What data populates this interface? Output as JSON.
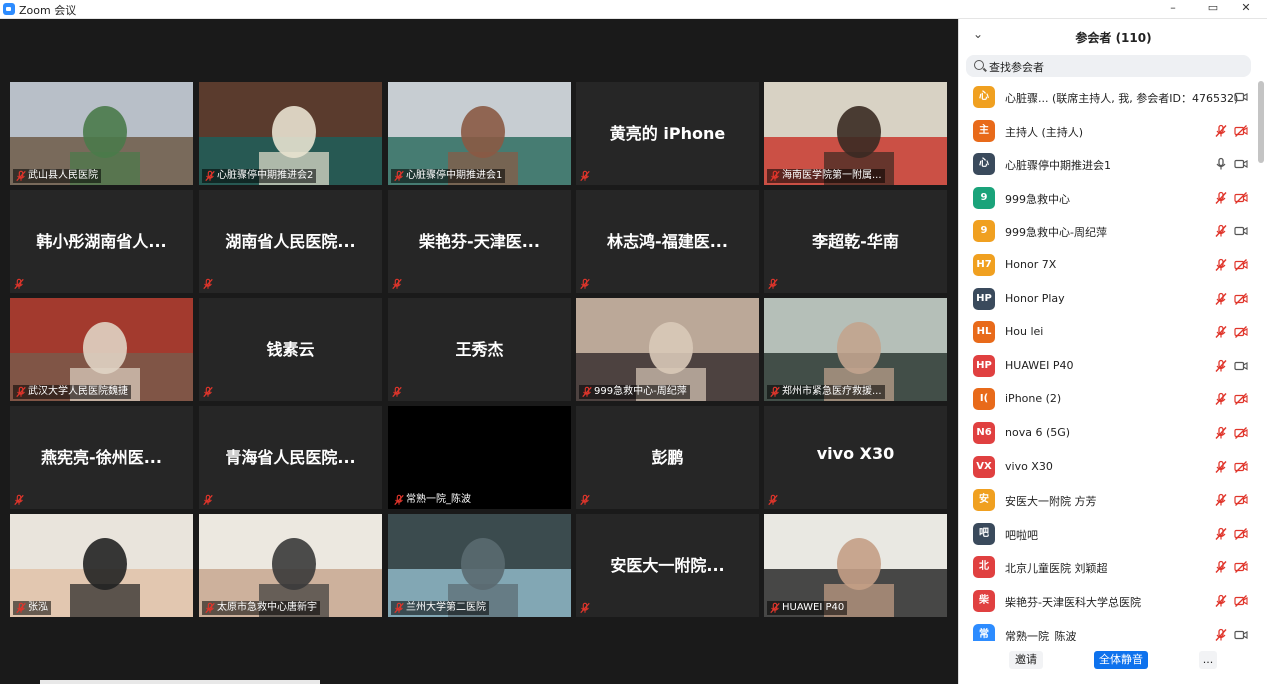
{
  "window": {
    "title": "Zoom 会议",
    "min": "–",
    "max": "▭",
    "close": "✕"
  },
  "tiles": [
    {
      "label": "武山县人民医院",
      "name": "",
      "video": true
    },
    {
      "label": "心脏骤停中期推进会2",
      "name": "",
      "video": true,
      "active": true
    },
    {
      "label": "心脏骤停中期推进会1",
      "name": "",
      "video": true
    },
    {
      "label": "",
      "name": "黄亮的 iPhone",
      "video": false
    },
    {
      "label": "海南医学院第一附属...",
      "name": "",
      "video": true
    },
    {
      "label": "",
      "name": "韩小彤湖南省人...",
      "video": false
    },
    {
      "label": "",
      "name": "湖南省人民医院...",
      "video": false
    },
    {
      "label": "",
      "name": "柴艳芬-天津医...",
      "video": false
    },
    {
      "label": "",
      "name": "林志鸿-福建医...",
      "video": false
    },
    {
      "label": "",
      "name": "李超乾-华南",
      "video": false
    },
    {
      "label": "武汉大学人民医院魏捷",
      "name": "",
      "video": true
    },
    {
      "label": "",
      "name": "钱素云",
      "video": false
    },
    {
      "label": "",
      "name": "王秀杰",
      "video": false
    },
    {
      "label": "999急救中心-周纪萍",
      "name": "",
      "video": true
    },
    {
      "label": "郑州市紧急医疗救援...",
      "name": "",
      "video": true
    },
    {
      "label": "",
      "name": "燕宪亮-徐州医...",
      "video": false
    },
    {
      "label": "",
      "name": "青海省人民医院...",
      "video": false
    },
    {
      "label": "常熟一院_陈波",
      "name": "",
      "video": true,
      "black": true
    },
    {
      "label": "",
      "name": "彭鹏",
      "video": false
    },
    {
      "label": "",
      "name": "vivo X30",
      "video": false
    },
    {
      "label": "张泓",
      "name": "",
      "video": true
    },
    {
      "label": "太原市急救中心唐新宇",
      "name": "",
      "video": true
    },
    {
      "label": "兰州大学第二医院",
      "name": "",
      "video": true
    },
    {
      "label": "",
      "name": "安医大一附院...",
      "video": false
    },
    {
      "label": "HUAWEI P40",
      "name": "",
      "video": true
    }
  ],
  "panel": {
    "title": "参会者 (110)",
    "search_placeholder": "查找参会者",
    "participants": [
      {
        "initial": "心",
        "name": "心脏骤...   (联席主持人, 我, 参会者ID：476532)",
        "color": "#f0a020",
        "mic": "none",
        "cam": "on"
      },
      {
        "initial": "主",
        "name": "主持人 (主持人)",
        "color": "#e86a1a",
        "mic": "muted",
        "cam": "off"
      },
      {
        "initial": "心",
        "name": "心脏骤停中期推进会1",
        "color": "#3a4a5c",
        "mic": "on",
        "cam": "on"
      },
      {
        "initial": "9",
        "name": "999急救中心",
        "color": "#1aa37a",
        "mic": "muted",
        "cam": "off"
      },
      {
        "initial": "9",
        "name": "999急救中心-周纪萍",
        "color": "#f0a020",
        "mic": "muted",
        "cam": "on"
      },
      {
        "initial": "H7",
        "name": "Honor 7X",
        "color": "#f0a020",
        "mic": "muted",
        "cam": "off"
      },
      {
        "initial": "HP",
        "name": "Honor Play",
        "color": "#3a4a5c",
        "mic": "muted",
        "cam": "off"
      },
      {
        "initial": "HL",
        "name": "Hou lei",
        "color": "#e86a1a",
        "mic": "muted",
        "cam": "off"
      },
      {
        "initial": "HP",
        "name": "HUAWEI P40",
        "color": "#e04040",
        "mic": "muted",
        "cam": "on"
      },
      {
        "initial": "I(",
        "name": "iPhone (2)",
        "color": "#e86a1a",
        "mic": "muted",
        "cam": "off"
      },
      {
        "initial": "N6",
        "name": "nova 6 (5G)",
        "color": "#e04040",
        "mic": "muted",
        "cam": "off"
      },
      {
        "initial": "VX",
        "name": "vivo X30",
        "color": "#e04040",
        "mic": "muted",
        "cam": "off"
      },
      {
        "initial": "安",
        "name": "安医大一附院 方芳",
        "color": "#f0a020",
        "mic": "muted",
        "cam": "off"
      },
      {
        "initial": "吧",
        "name": "吧啦吧",
        "color": "#3a4a5c",
        "mic": "muted",
        "cam": "off"
      },
      {
        "initial": "北",
        "name": "北京儿童医院 刘颖超",
        "color": "#e04040",
        "mic": "muted",
        "cam": "off"
      },
      {
        "initial": "柴",
        "name": "柴艳芬-天津医科大学总医院",
        "color": "#e04040",
        "mic": "muted",
        "cam": "off"
      },
      {
        "initial": "常",
        "name": "常熟一院_陈波",
        "color": "#2d8cff",
        "mic": "muted",
        "cam": "on"
      }
    ],
    "invite": "邀请",
    "mute_all": "全体静音",
    "more": "..."
  },
  "colors": {
    "active_border": "#c9e34a",
    "muted_red": "#e0352b",
    "accent_blue": "#0e72ed"
  }
}
